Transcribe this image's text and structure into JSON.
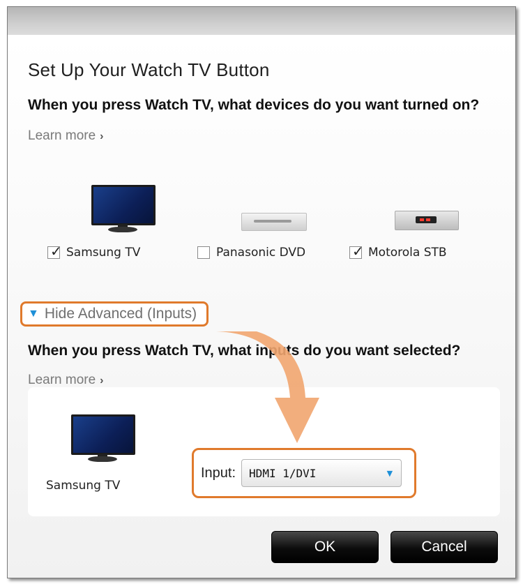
{
  "dialog": {
    "title": "Set Up Your Watch TV Button",
    "devices_question": "When you press Watch TV, what devices do you want turned on?",
    "learn_more": "Learn more",
    "devices": [
      {
        "label": "Samsung TV",
        "checked": true,
        "icon": "tv-icon"
      },
      {
        "label": "Panasonic DVD",
        "checked": false,
        "icon": "dvd-player-icon"
      },
      {
        "label": "Motorola STB",
        "checked": true,
        "icon": "set-top-box-icon"
      }
    ],
    "advanced_toggle": "Hide Advanced (Inputs)",
    "inputs_question": "When you press Watch TV, what inputs do you want selected?",
    "learn_more_2": "Learn more",
    "input_device_label": "Samsung TV",
    "input_label": "Input:",
    "input_value": "HDMI 1/DVI",
    "ok_label": "OK",
    "cancel_label": "Cancel"
  },
  "colors": {
    "highlight": "#e07a2c",
    "arrow": "#f1a56f",
    "accent": "#1e90d8",
    "button": "#000000"
  }
}
